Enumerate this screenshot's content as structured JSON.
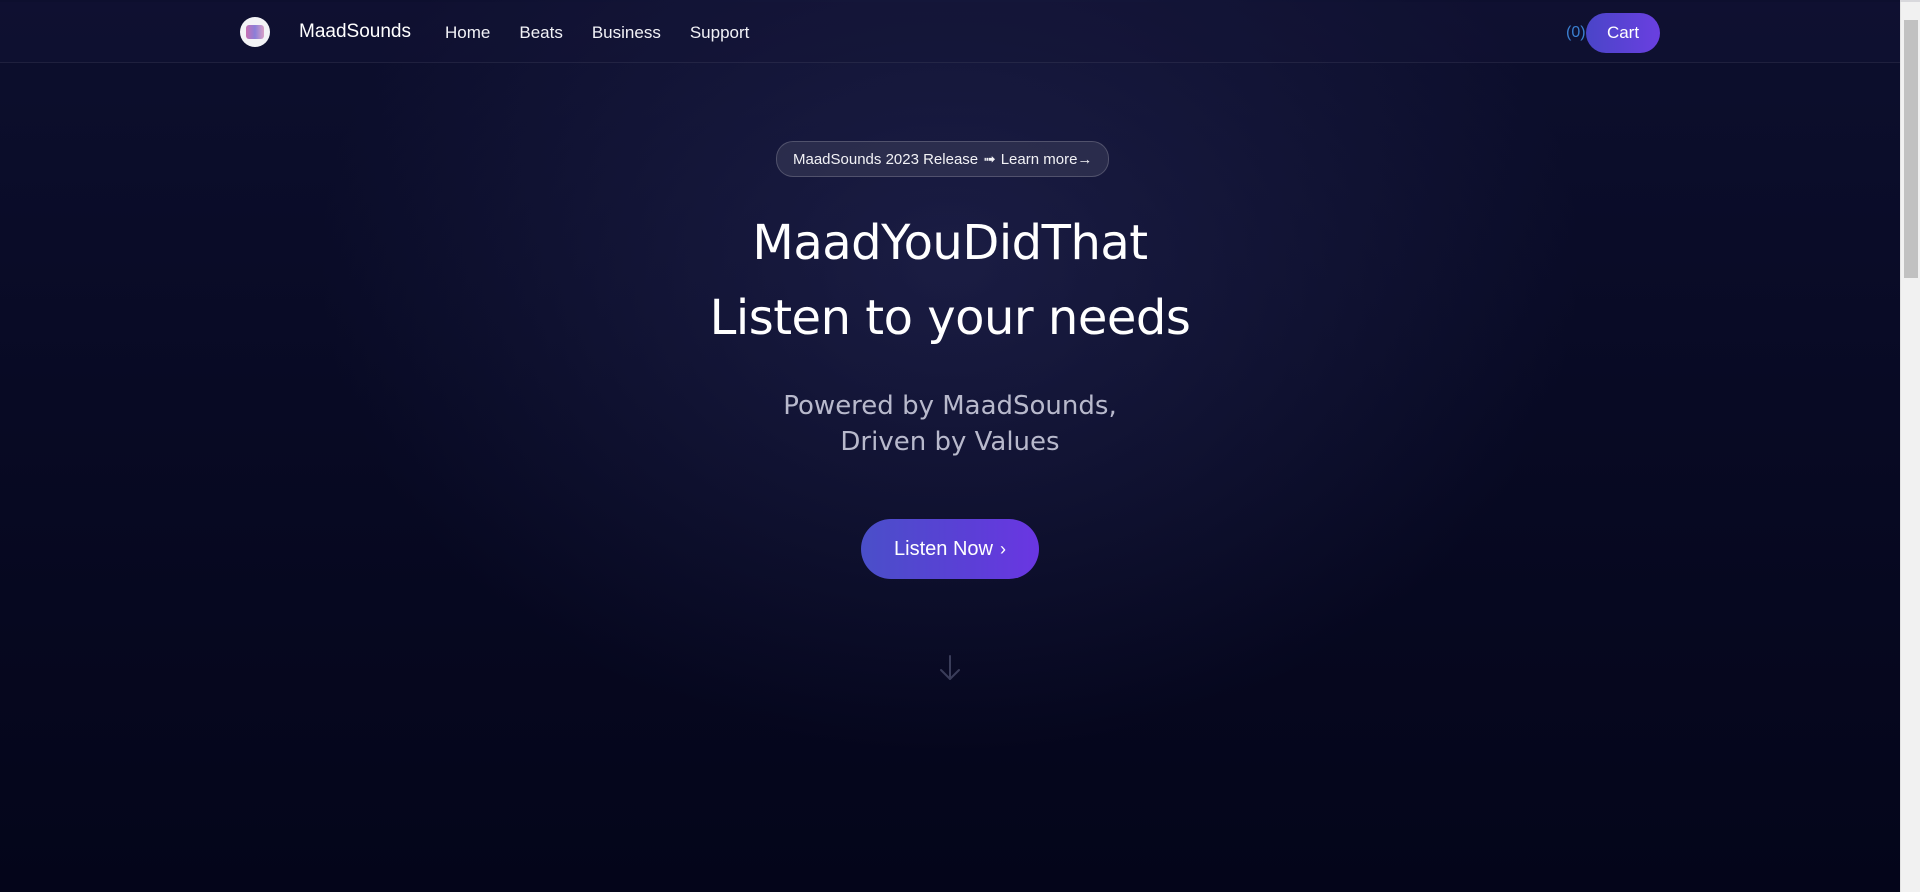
{
  "nav": {
    "brand": "MaadSounds",
    "links": [
      "Home",
      "Beats",
      "Business",
      "Support"
    ],
    "cart_count": "(0)",
    "cart_label": "Cart"
  },
  "hero": {
    "release_text": "MaadSounds 2023 Release",
    "release_arrow": "➟",
    "learn_more": "Learn more→",
    "title_line1": "MaadYouDidThat",
    "title_line2": "Listen to your needs",
    "subtitle_line1": "Powered by MaadSounds,",
    "subtitle_line2": "Driven by Values",
    "cta_label": "Listen Now",
    "cta_chevron": "›"
  },
  "icons": {
    "logo": "maadsounds-logo",
    "scroll": "arrow-down-icon"
  },
  "colors": {
    "accent_start": "#4a4fc9",
    "accent_end": "#6a36e2",
    "background": "#05061a",
    "cart_count": "#3a7fd0"
  }
}
